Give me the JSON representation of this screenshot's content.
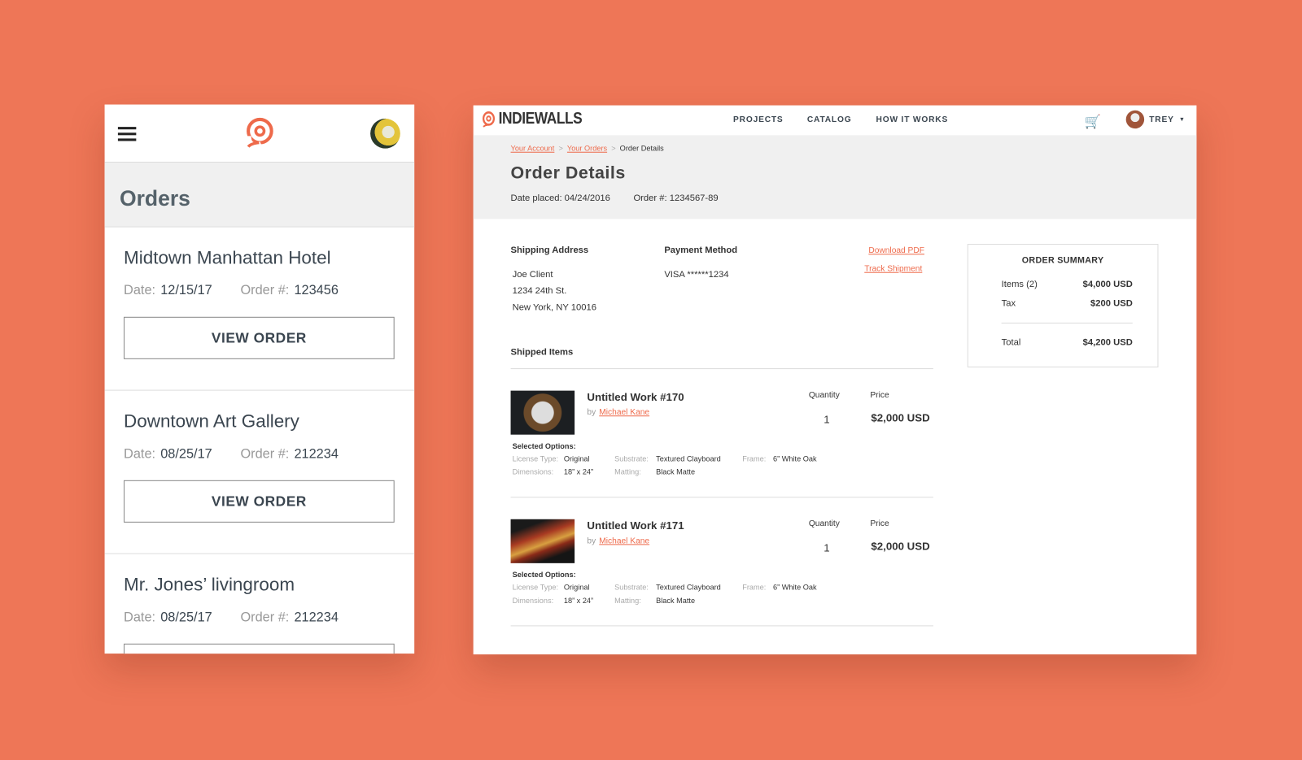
{
  "colors": {
    "background": "#EE7657",
    "accent": "#EE6A4B"
  },
  "mobile": {
    "menu_icon": "hamburger-icon",
    "logo_icon": "indiewalls-logo-icon",
    "title": "Orders",
    "date_label": "Date:",
    "order_label": "Order #:",
    "button_label": "VIEW ORDER",
    "orders": [
      {
        "name": "Midtown Manhattan Hotel",
        "date": "12/15/17",
        "order": "123456"
      },
      {
        "name": "Downtown Art Gallery",
        "date": "08/25/17",
        "order": "212234"
      },
      {
        "name": "Mr. Jones’ livingroom",
        "date": "08/25/17",
        "order": "212234"
      }
    ]
  },
  "desktop": {
    "brand": "INDIEWALLS",
    "nav": [
      "PROJECTS",
      "CATALOG",
      "HOW IT WORKS"
    ],
    "cart_icon": "cart-icon",
    "user": "TREY",
    "breadcrumb": [
      "Your Account",
      "Your Orders",
      "Order Details"
    ],
    "title": "Order Details",
    "date_placed": "Date placed: 04/24/2016",
    "order_number": "Order #: 1234567-89",
    "shipping": {
      "label": "Shipping Address",
      "lines": [
        "Joe Client",
        "1234 24th St.",
        "New York, NY 10016"
      ]
    },
    "payment": {
      "label": "Payment Method",
      "value": "VISA ******1234"
    },
    "download_pdf": "Download PDF",
    "track_shipment": "Track Shipment",
    "shipped_label": "Shipped Items",
    "quantity_label": "Quantity",
    "price_label": "Price",
    "by_label": "by",
    "options_label": "Selected Options:",
    "option_keys": {
      "license": "License Type:",
      "substrate": "Substrate:",
      "frame": "Frame:",
      "dimensions": "Dimensions:",
      "matting": "Matting:"
    },
    "items": [
      {
        "title": "Untitled Work #170",
        "artist": "Michael Kane",
        "quantity": "1",
        "price": "$2,000 USD",
        "license": "Original",
        "substrate": "Textured Clayboard",
        "frame": "6” White Oak",
        "dimensions": "18” x 24”",
        "matting": "Black Matte"
      },
      {
        "title": "Untitled Work #171",
        "artist": "Michael Kane",
        "quantity": "1",
        "price": "$2,000 USD",
        "license": "Original",
        "substrate": "Textured Clayboard",
        "frame": "6” White Oak",
        "dimensions": "18” x 24”",
        "matting": "Black Matte"
      }
    ],
    "summary": {
      "title": "ORDER SUMMARY",
      "items_label": "Items (2)",
      "items_value": "$4,000 USD",
      "tax_label": "Tax",
      "tax_value": "$200 USD",
      "total_label": "Total",
      "total_value": "$4,200 USD"
    }
  }
}
